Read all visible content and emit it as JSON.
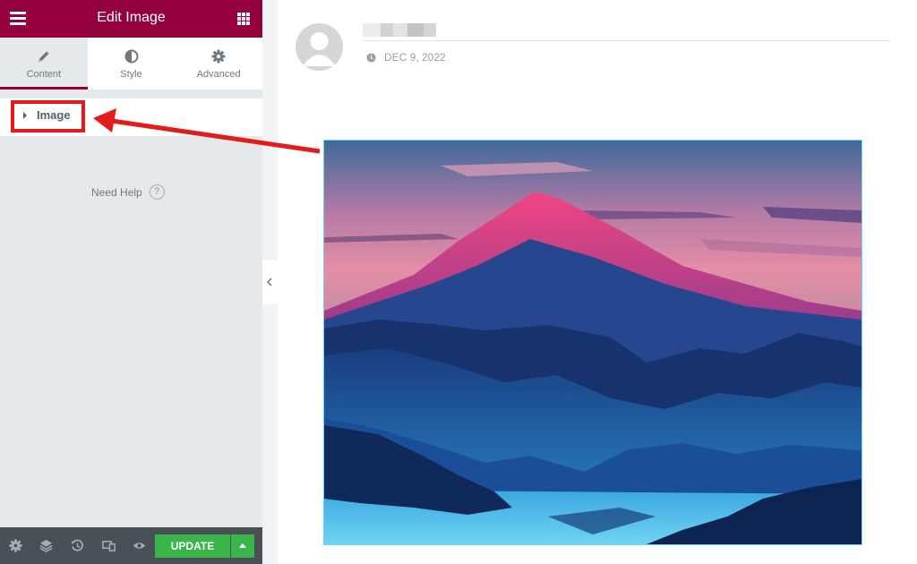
{
  "header": {
    "title": "Edit Image",
    "menu_icon": "hamburger-icon",
    "apps_icon": "grid-icon",
    "color": "#93003c"
  },
  "tabs": [
    {
      "label": "Content",
      "icon": "pencil-icon",
      "active": true
    },
    {
      "label": "Style",
      "icon": "half-circle-icon",
      "active": false
    },
    {
      "label": "Advanced",
      "icon": "gear-icon",
      "active": false
    }
  ],
  "section": {
    "label": "Image",
    "icon": "caret-right-icon",
    "highlight_color": "#e41b1b"
  },
  "help": {
    "label": "Need Help",
    "icon": "question-icon"
  },
  "footer": {
    "update_label": "UPDATE",
    "icons": [
      "settings-icon",
      "layers-icon",
      "history-icon",
      "responsive-icon",
      "preview-icon"
    ],
    "update_color": "#39b54a"
  },
  "post": {
    "date": "DEC 9, 2022",
    "date_icon": "clock-icon",
    "avatar_icon": "user-avatar-icon"
  },
  "colors": {
    "sidebar_bg": "#e6e9ec",
    "image_border": "#71d7f7",
    "annotation_arrow": "#e41b1b"
  }
}
